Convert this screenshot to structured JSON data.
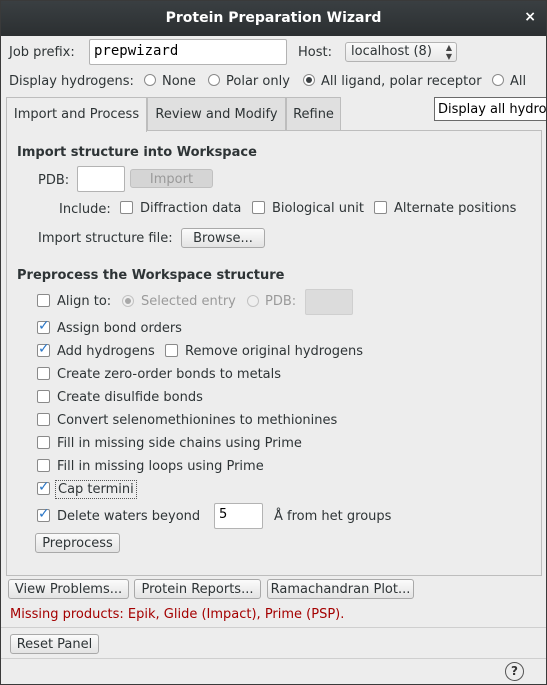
{
  "window": {
    "title": "Protein Preparation Wizard",
    "close_glyph": "×"
  },
  "job": {
    "prefix_label": "Job prefix:",
    "prefix_value": "prepwizard",
    "host_label": "Host:",
    "host_value": "localhost (8)"
  },
  "hydrogens": {
    "label": "Display hydrogens:",
    "options": [
      "None",
      "Polar only",
      "All ligand, polar receptor",
      "All"
    ],
    "selected": "All ligand, polar receptor"
  },
  "tooltip": "Display all hydrog",
  "tabs": [
    "Import and Process",
    "Review and Modify",
    "Refine"
  ],
  "import_section": {
    "title": "Import structure into Workspace",
    "pdb_label": "PDB:",
    "pdb_value": "",
    "import_button": "Import",
    "include_label": "Include:",
    "include_options": [
      "Diffraction data",
      "Biological unit",
      "Alternate positions"
    ],
    "file_label": "Import structure file:",
    "browse_button": "Browse..."
  },
  "preprocess_section": {
    "title": "Preprocess the Workspace structure",
    "align_label": "Align to:",
    "align_selected": "Selected entry",
    "align_pdb": "PDB:",
    "assign_bond_orders": "Assign bond orders",
    "add_hydrogens": "Add hydrogens",
    "remove_hydrogens": "Remove original hydrogens",
    "zero_order_bonds": "Create zero-order bonds to metals",
    "disulfide_bonds": "Create disulfide bonds",
    "selenomethionines": "Convert selenomethionines to methionines",
    "side_chains": "Fill in missing side chains using Prime",
    "missing_loops": "Fill in missing loops using Prime",
    "cap_termini": "Cap termini",
    "delete_waters": "Delete waters beyond",
    "delete_waters_value": "5",
    "delete_waters_suffix": "Å from het groups",
    "preprocess_button": "Preprocess"
  },
  "bottom": {
    "view_problems": "View Problems...",
    "protein_reports": "Protein Reports...",
    "ramachandran": "Ramachandran Plot...",
    "missing": "Missing products: Epik, Glide (Impact), Prime (PSP).",
    "reset": "Reset Panel",
    "help": "?"
  },
  "colors": {
    "titlebar": "#2b2f31",
    "warning": "#a40000",
    "check": "#2a76c6"
  }
}
